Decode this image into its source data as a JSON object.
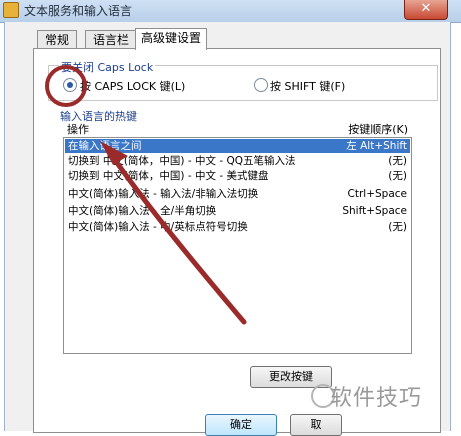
{
  "window": {
    "title": "文本服务和输入语言",
    "close_label": "✕"
  },
  "tabs": [
    {
      "label": "常规",
      "active": false
    },
    {
      "label": "语言栏",
      "active": false
    },
    {
      "label": "高级键设置",
      "active": true
    }
  ],
  "caps_lock": {
    "group_title": "要关闭 Caps Lock",
    "options": [
      {
        "label": "按 CAPS LOCK 键(L)",
        "selected": true
      },
      {
        "label": "按 SHIFT 键(F)",
        "selected": false
      }
    ]
  },
  "hotkeys": {
    "section_title": "输入语言的热键",
    "columns": {
      "action": "操作",
      "key": "按键顺序(K)"
    },
    "rows": [
      {
        "action": "在输入语言之间",
        "key": "左 Alt+Shift",
        "selected": true
      },
      {
        "action": "切换到 中文(简体，中国) - 中文 - QQ五笔输入法",
        "key": "(无)",
        "selected": false
      },
      {
        "action": "切换到 中文(简体，中国) - 中文 - 美式键盘",
        "key": "(无)",
        "selected": false
      },
      {
        "action": "中文(简体)输入法 - 输入法/非输入法切换",
        "key": "Ctrl+Space",
        "selected": false
      },
      {
        "action": "中文(简体)输入法 - 全/半角切换",
        "key": "Shift+Space",
        "selected": false
      },
      {
        "action": "中文(简体)输入法 - 中/英标点符号切换",
        "key": "(无)",
        "selected": false
      }
    ]
  },
  "buttons": {
    "change_key": "更改按键",
    "ok": "确定",
    "cancel": "取"
  },
  "watermark": "软件技巧",
  "colors": {
    "selection": "#3a77c8",
    "annotation": "#9b2a2a"
  }
}
